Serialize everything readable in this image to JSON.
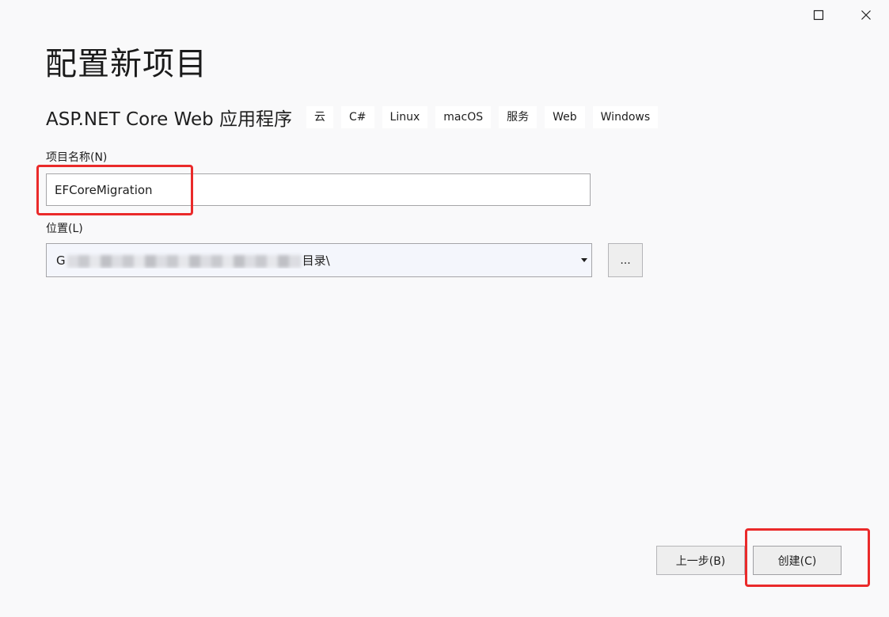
{
  "window": {
    "maximize_icon": "maximize-icon",
    "close_icon": "close-icon"
  },
  "page_title": "配置新项目",
  "template": {
    "name": "ASP.NET Core Web 应用程序",
    "tags": [
      "云",
      "C#",
      "Linux",
      "macOS",
      "服务",
      "Web",
      "Windows"
    ]
  },
  "project_name": {
    "label": "项目名称(N)",
    "value": "EFCoreMigration"
  },
  "location": {
    "label": "位置(L)",
    "value_prefix": "G",
    "value_suffix": "目录\\",
    "browse_label": "..."
  },
  "footer": {
    "back_label": "上一步(B)",
    "create_label": "创建(C)"
  },
  "colors": {
    "annotation_red": "#ea2a2a",
    "background": "#f9f9fa"
  }
}
